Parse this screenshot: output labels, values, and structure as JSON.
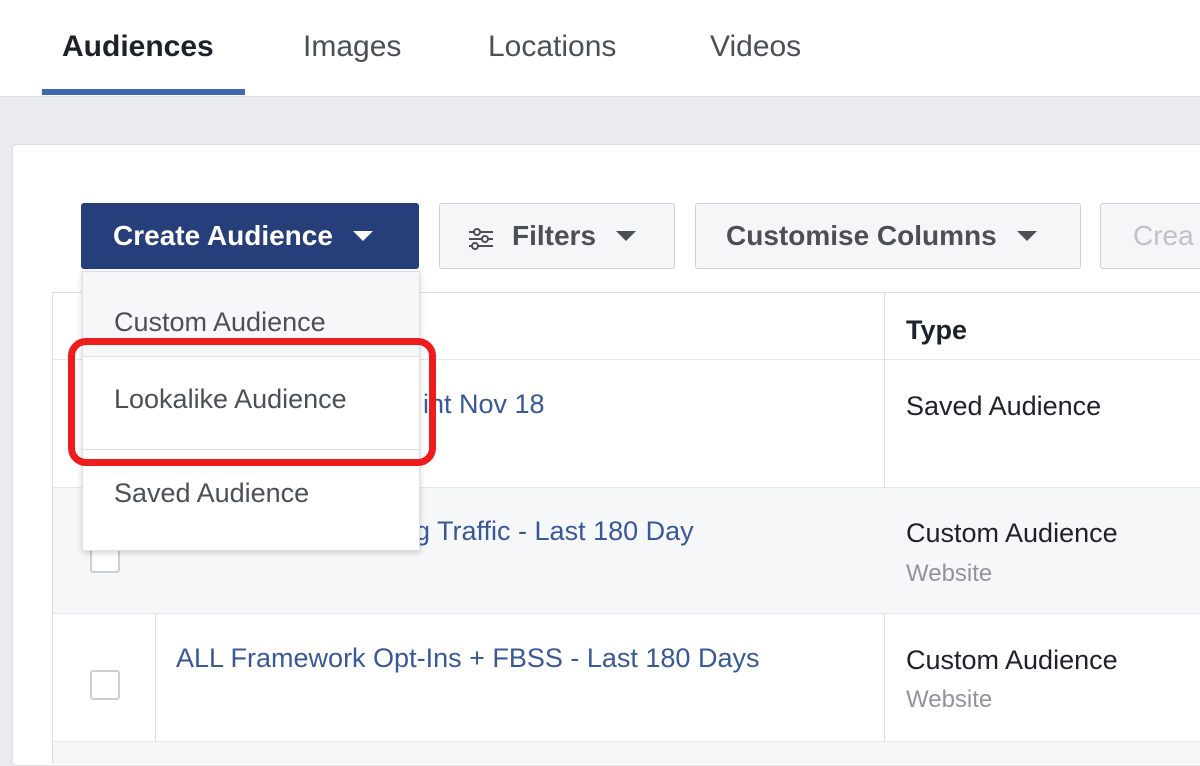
{
  "tabs": [
    {
      "label": "Audiences",
      "active": true
    },
    {
      "label": "Images",
      "active": false
    },
    {
      "label": "Locations",
      "active": false
    },
    {
      "label": "Videos",
      "active": false
    }
  ],
  "toolbar": {
    "create_audience_label": "Create Audience",
    "filters_label": "Filters",
    "customise_columns_label": "Customise Columns",
    "partial_button_label": "Crea"
  },
  "dropdown": {
    "items": [
      "Custom Audience",
      "Lookalike Audience",
      "Saved Audience"
    ],
    "highlighted_item": "Lookalike Audience"
  },
  "table": {
    "type_header": "Type",
    "rows": [
      {
        "name_visible": "int Nov 18",
        "type": "Saved Audience",
        "subtype": ""
      },
      {
        "name_visible": "g Traffic - Last 180 Day",
        "type": "Custom Audience",
        "subtype": "Website"
      },
      {
        "name_visible": "ALL Framework Opt-Ins + FBSS - Last 180 Days",
        "type": "Custom Audience",
        "subtype": "Website"
      }
    ]
  },
  "colors": {
    "primary_button": "#263f7a",
    "tab_underline": "#4267b2",
    "link": "#385898",
    "highlight": "#ee1c1c"
  },
  "icons": {
    "filters": "sliders-icon",
    "caret": "caret-down-icon"
  }
}
